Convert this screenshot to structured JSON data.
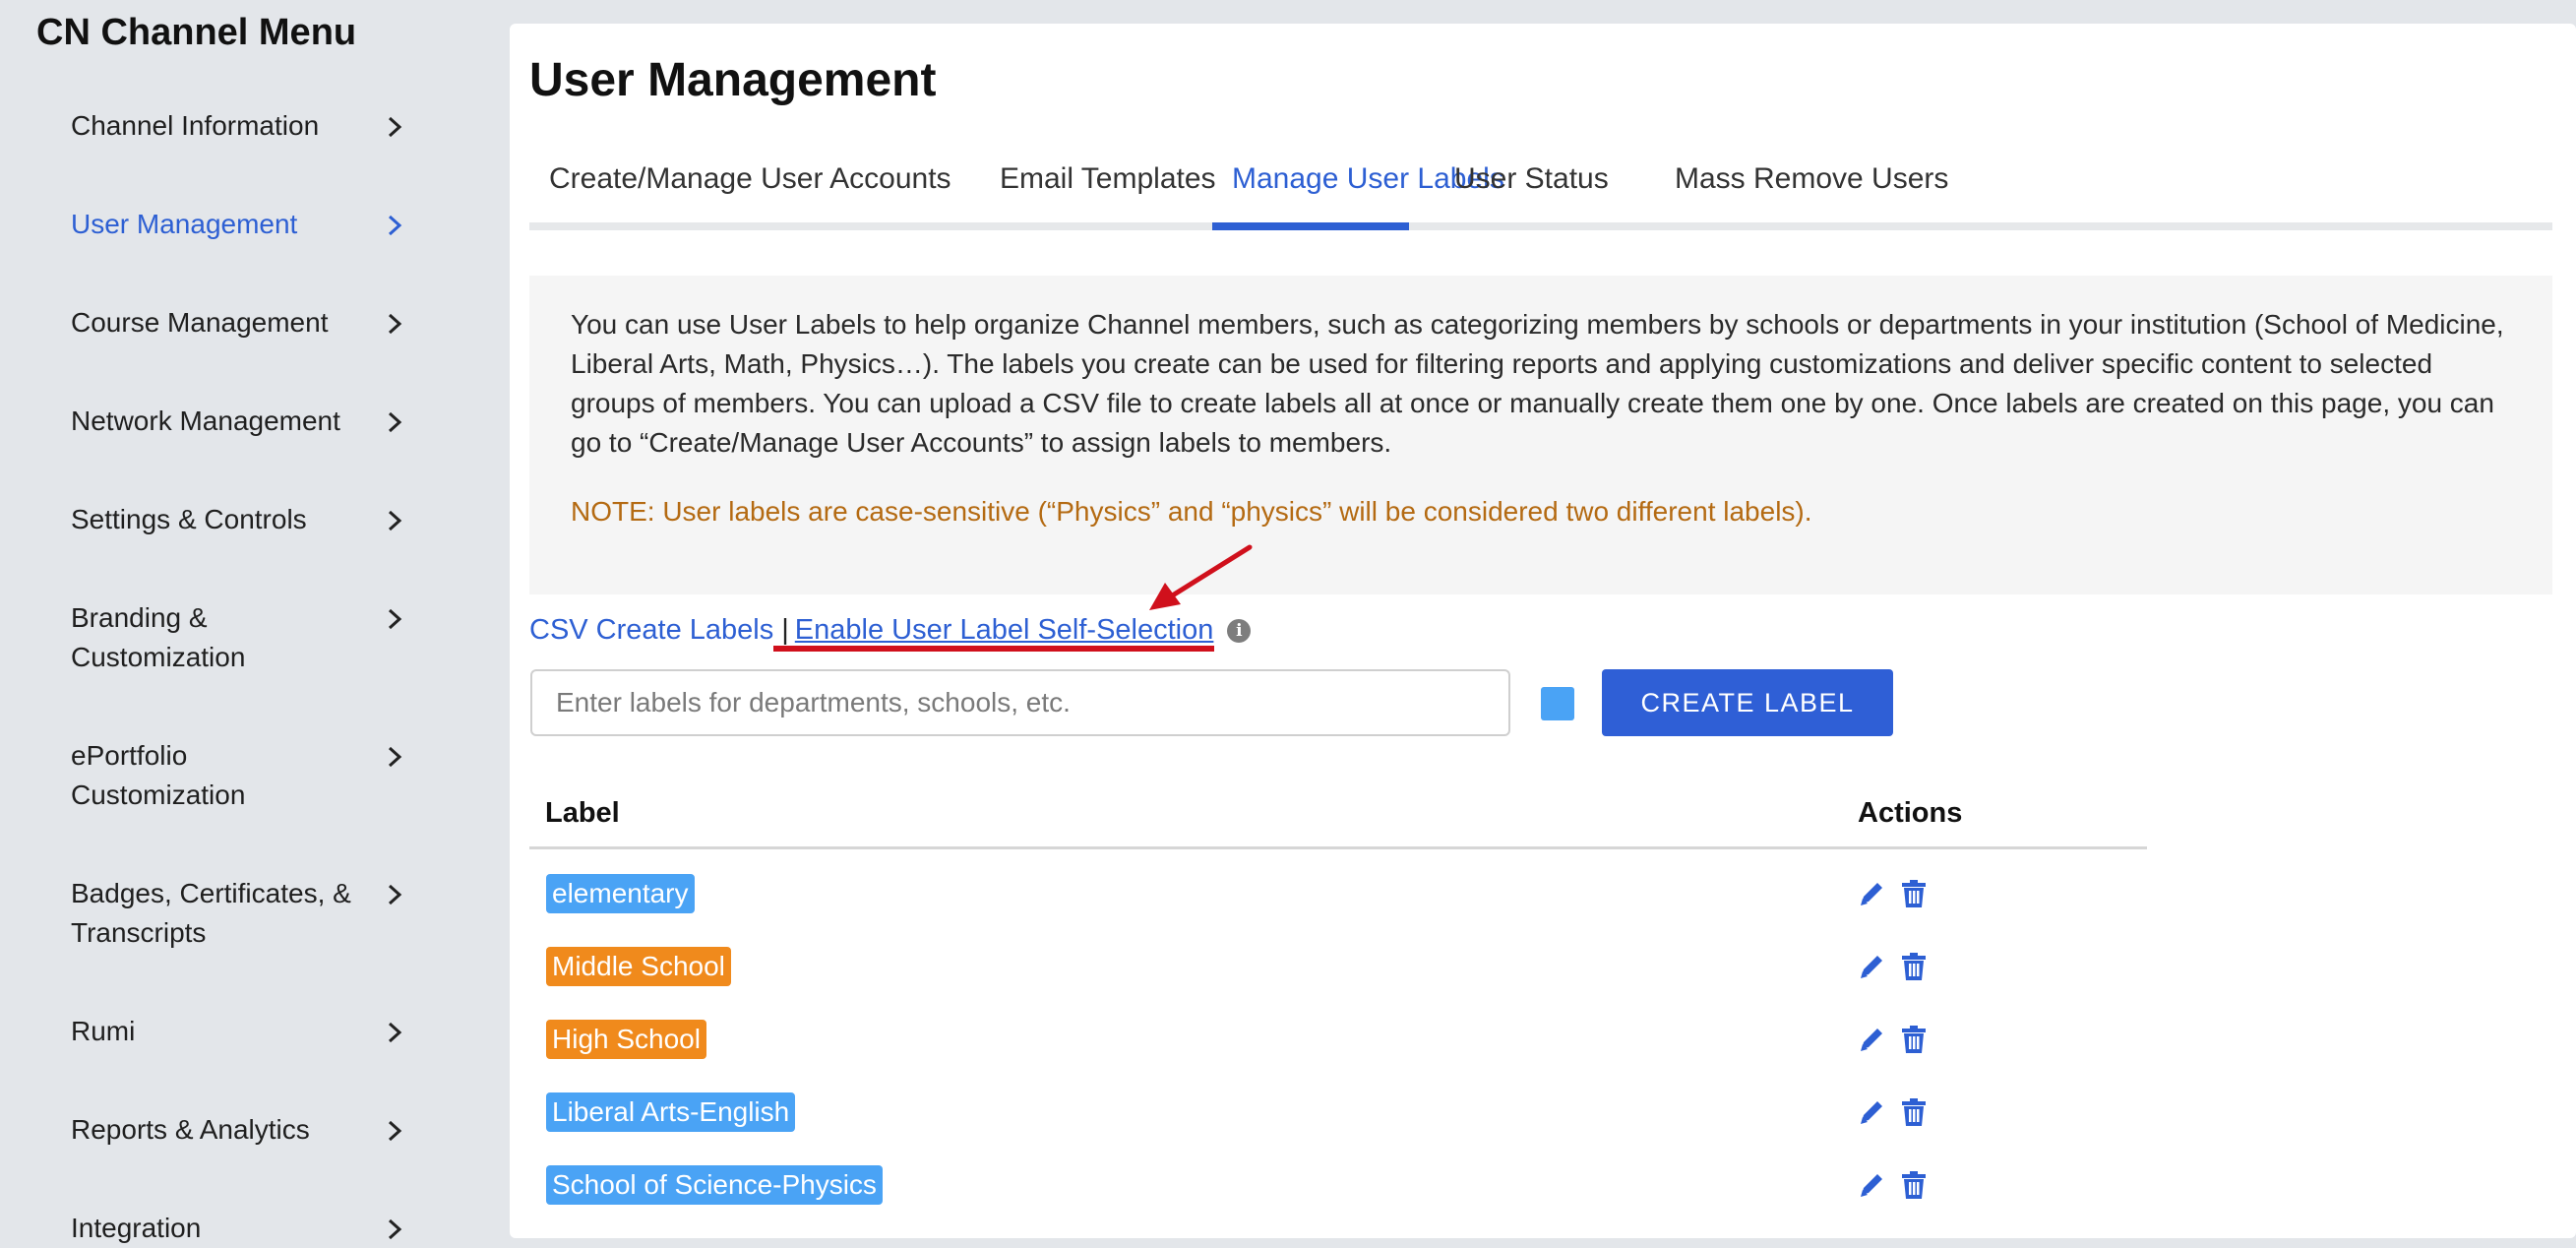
{
  "sidebar": {
    "title": "CN Channel Menu",
    "items": [
      {
        "label": "Channel Information"
      },
      {
        "label": "User Management"
      },
      {
        "label": "Course Management"
      },
      {
        "label": "Network Management"
      },
      {
        "label": "Settings & Controls"
      },
      {
        "label": "Branding & Customization"
      },
      {
        "label": "ePortfolio Customization"
      },
      {
        "label": "Badges, Certificates, & Transcripts"
      },
      {
        "label": "Rumi"
      },
      {
        "label": "Reports & Analytics"
      },
      {
        "label": "Integration"
      }
    ],
    "active_index": 1,
    "icon": "chevron-right-icon"
  },
  "main": {
    "title": "User Management",
    "tabs": [
      {
        "label": "Create/Manage User Accounts"
      },
      {
        "label": "Email Templates"
      },
      {
        "label": "Manage User Labels"
      },
      {
        "label": "User Status"
      },
      {
        "label": "Mass Remove Users"
      }
    ],
    "active_tab": 2,
    "info": {
      "text": "You can use User Labels to help organize Channel members, such as categorizing members by schools or departments in your institution (School of Medicine, Liberal Arts, Math, Physics…). The labels you create can be used for filtering reports and applying customizations and deliver specific content to selected groups of members. You can upload a CSV file to create labels all at once or manually create them one by one. Once labels are created on this page, you can go to “Create/Manage User Accounts” to assign labels to members.",
      "note": "NOTE: User labels are case-sensitive (“Physics” and “physics” will be considered two different labels)."
    },
    "links": {
      "csv": "CSV Create Labels",
      "separator": "|",
      "self_selection": "Enable User Label Self-Selection",
      "info_icon": "i"
    },
    "form": {
      "placeholder": "Enter labels for departments, schools, etc.",
      "value": "",
      "swatch_color": "#4aa3f5",
      "create_label": "CREATE LABEL"
    },
    "table": {
      "columns": [
        "Label",
        "Actions"
      ],
      "rows": [
        {
          "label": "elementary",
          "color": "#4aa3f5"
        },
        {
          "label": "Middle School",
          "color": "#f08a1c"
        },
        {
          "label": "High School",
          "color": "#f08a1c"
        },
        {
          "label": "Liberal Arts-English",
          "color": "#4aa3f5"
        },
        {
          "label": "School of Science-Physics",
          "color": "#4aa3f5"
        }
      ],
      "action_icons": [
        "pencil-icon",
        "trash-icon"
      ]
    }
  },
  "colors": {
    "accent": "#2d5fd3",
    "note": "#b46a12",
    "annotation": "#d0101c",
    "background": "#e3e6ea"
  }
}
